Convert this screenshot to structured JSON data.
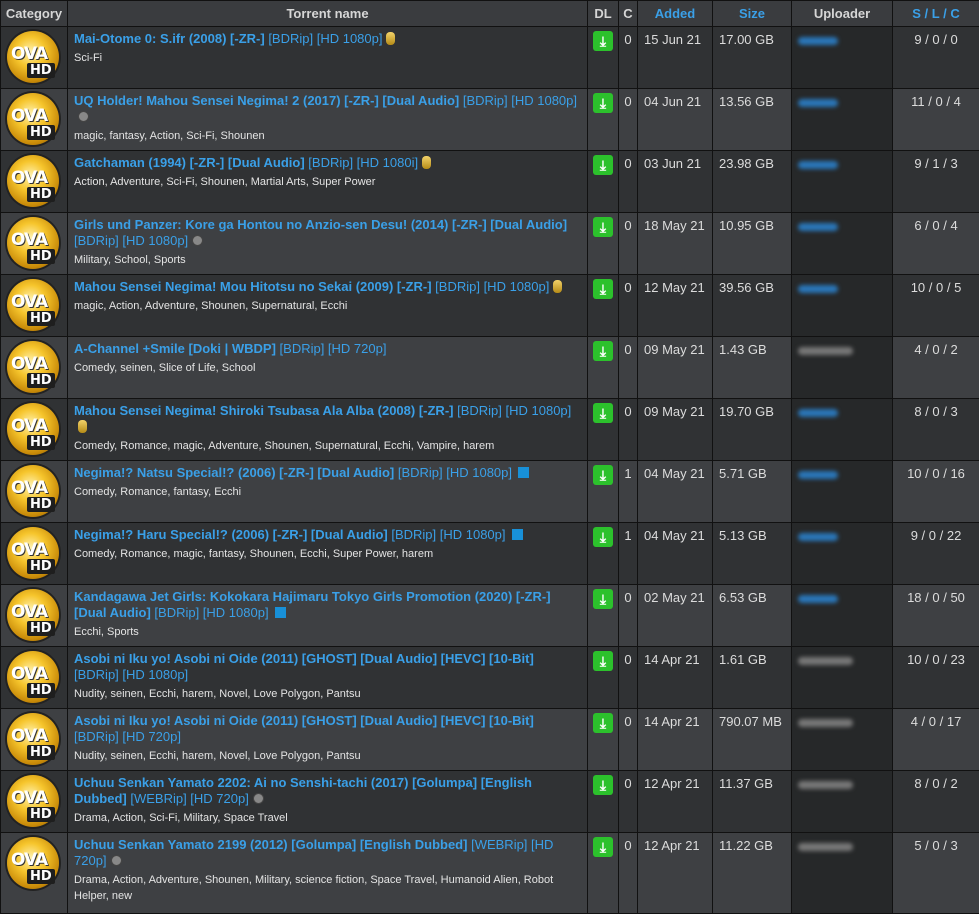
{
  "headers": {
    "category": "Category",
    "name": "Torrent name",
    "dl": "DL",
    "c": "C",
    "added": "Added",
    "size": "Size",
    "uploader": "Uploader",
    "s": "S",
    "l": "L",
    "cc": "C",
    "sep": "/"
  },
  "category_icon": {
    "top": "OVA",
    "bottom": "HD"
  },
  "download_icon": "⤓",
  "rows": [
    {
      "title": "Mai-Otome 0: S.ifr (2008) [-ZR-]",
      "tags_bracket": "[BDRip] [HD 1080p]",
      "icon": "badge",
      "genres": "Sci-Fi",
      "c": "0",
      "added": "15 Jun 21",
      "size": "17.00 GB",
      "uploader": "b",
      "slc": "9 / 0 / 0"
    },
    {
      "title": "UQ Holder! Mahou Sensei Negima! 2 (2017) [-ZR-] [Dual Audio]",
      "tags_bracket": "[BDRip] [HD 1080p]",
      "icon": "dot",
      "genres": "magic, fantasy, Action, Sci-Fi, Shounen",
      "c": "0",
      "added": "04 Jun 21",
      "size": "13.56 GB",
      "uploader": "b",
      "slc": "11 / 0 / 4"
    },
    {
      "title": "Gatchaman (1994) [-ZR-] [Dual Audio]",
      "tags_bracket": "[BDRip] [HD 1080i]",
      "icon": "badge",
      "genres": "Action, Adventure, Sci-Fi, Shounen, Martial Arts, Super Power",
      "c": "0",
      "added": "03 Jun 21",
      "size": "23.98 GB",
      "uploader": "b",
      "slc": "9 / 1 / 3"
    },
    {
      "title": "Girls und Panzer: Kore ga Hontou no Anzio-sen Desu! (2014) [-ZR-] [Dual Audio]",
      "tags_bracket": "[BDRip] [HD 1080p]",
      "icon": "dot",
      "genres": "Military, School, Sports",
      "c": "0",
      "added": "18 May 21",
      "size": "10.95 GB",
      "uploader": "b",
      "slc": "6 / 0 / 4"
    },
    {
      "title": "Mahou Sensei Negima! Mou Hitotsu no Sekai (2009) [-ZR-]",
      "tags_bracket": "[BDRip] [HD 1080p]",
      "icon": "badge",
      "genres": "magic, Action, Adventure, Shounen, Supernatural, Ecchi",
      "c": "0",
      "added": "12 May 21",
      "size": "39.56 GB",
      "uploader": "b",
      "slc": "10 / 0 / 5"
    },
    {
      "title": "A-Channel +Smile [Doki | WBDP]",
      "tags_bracket": "[BDRip] [HD 720p]",
      "icon": "",
      "genres": "Comedy, seinen, Slice of Life, School",
      "c": "0",
      "added": "09 May 21",
      "size": "1.43 GB",
      "uploader": "g",
      "slc": "4 / 0 / 2"
    },
    {
      "title": "Mahou Sensei Negima! Shiroki Tsubasa Ala Alba (2008) [-ZR-]",
      "tags_bracket": "[BDRip] [HD 1080p]",
      "icon": "badge",
      "genres": "Comedy, Romance, magic, Adventure, Shounen, Supernatural, Ecchi, Vampire, harem",
      "c": "0",
      "added": "09 May 21",
      "size": "19.70 GB",
      "uploader": "b",
      "slc": "8 / 0 / 3"
    },
    {
      "title": "Negima!? Natsu Special!? (2006) [-ZR-] [Dual Audio]",
      "tags_bracket": "[BDRip] [HD 1080p]",
      "icon": "sq",
      "genres": "Comedy, Romance, fantasy, Ecchi",
      "c": "1",
      "added": "04 May 21",
      "size": "5.71 GB",
      "uploader": "b",
      "slc": "10 / 0 / 16"
    },
    {
      "title": "Negima!? Haru Special!? (2006) [-ZR-] [Dual Audio]",
      "tags_bracket": "[BDRip] [HD 1080p]",
      "icon": "sq",
      "genres": "Comedy, Romance, magic, fantasy, Shounen, Ecchi, Super Power, harem",
      "c": "1",
      "added": "04 May 21",
      "size": "5.13 GB",
      "uploader": "b",
      "slc": "9 / 0 / 22"
    },
    {
      "title": "Kandagawa Jet Girls: Kokokara Hajimaru Tokyo Girls Promotion (2020) [-ZR-] [Dual Audio]",
      "tags_bracket": "[BDRip] [HD 1080p]",
      "icon": "sq",
      "genres": "Ecchi, Sports",
      "c": "0",
      "added": "02 May 21",
      "size": "6.53 GB",
      "uploader": "b",
      "slc": "18 / 0 / 50"
    },
    {
      "title": "Asobi ni Iku yo! Asobi ni Oide (2011) [GHOST] [Dual Audio] [HEVC] [10-Bit]",
      "tags_bracket": "[BDRip] [HD 1080p]",
      "icon": "",
      "genres": "Nudity, seinen, Ecchi, harem, Novel, Love Polygon, Pantsu",
      "c": "0",
      "added": "14 Apr 21",
      "size": "1.61 GB",
      "uploader": "g",
      "slc": "10 / 0 / 23"
    },
    {
      "title": "Asobi ni Iku yo! Asobi ni Oide (2011) [GHOST] [Dual Audio] [HEVC] [10-Bit]",
      "tags_bracket": "[BDRip] [HD 720p]",
      "icon": "",
      "genres": "Nudity, seinen, Ecchi, harem, Novel, Love Polygon, Pantsu",
      "c": "0",
      "added": "14 Apr 21",
      "size": "790.07 MB",
      "uploader": "g",
      "slc": "4 / 0 / 17"
    },
    {
      "title": "Uchuu Senkan Yamato 2202: Ai no Senshi-tachi (2017) [Golumpa] [English Dubbed]",
      "tags_bracket": "[WEBRip] [HD 720p]",
      "icon": "dot",
      "genres": "Drama, Action, Sci-Fi, Military, Space Travel",
      "c": "0",
      "added": "12 Apr 21",
      "size": "11.37 GB",
      "uploader": "g",
      "slc": "8 / 0 / 2"
    },
    {
      "title": "Uchuu Senkan Yamato 2199 (2012) [Golumpa] [English Dubbed]",
      "tags_bracket": "[WEBRip] [HD 720p]",
      "icon": "dot",
      "genres": "Drama, Action, Adventure, Shounen, Military, science fiction, Space Travel, Humanoid Alien, Robot Helper, new",
      "c": "0",
      "added": "12 Apr 21",
      "size": "11.22 GB",
      "uploader": "g",
      "slc": "5 / 0 / 3"
    }
  ]
}
